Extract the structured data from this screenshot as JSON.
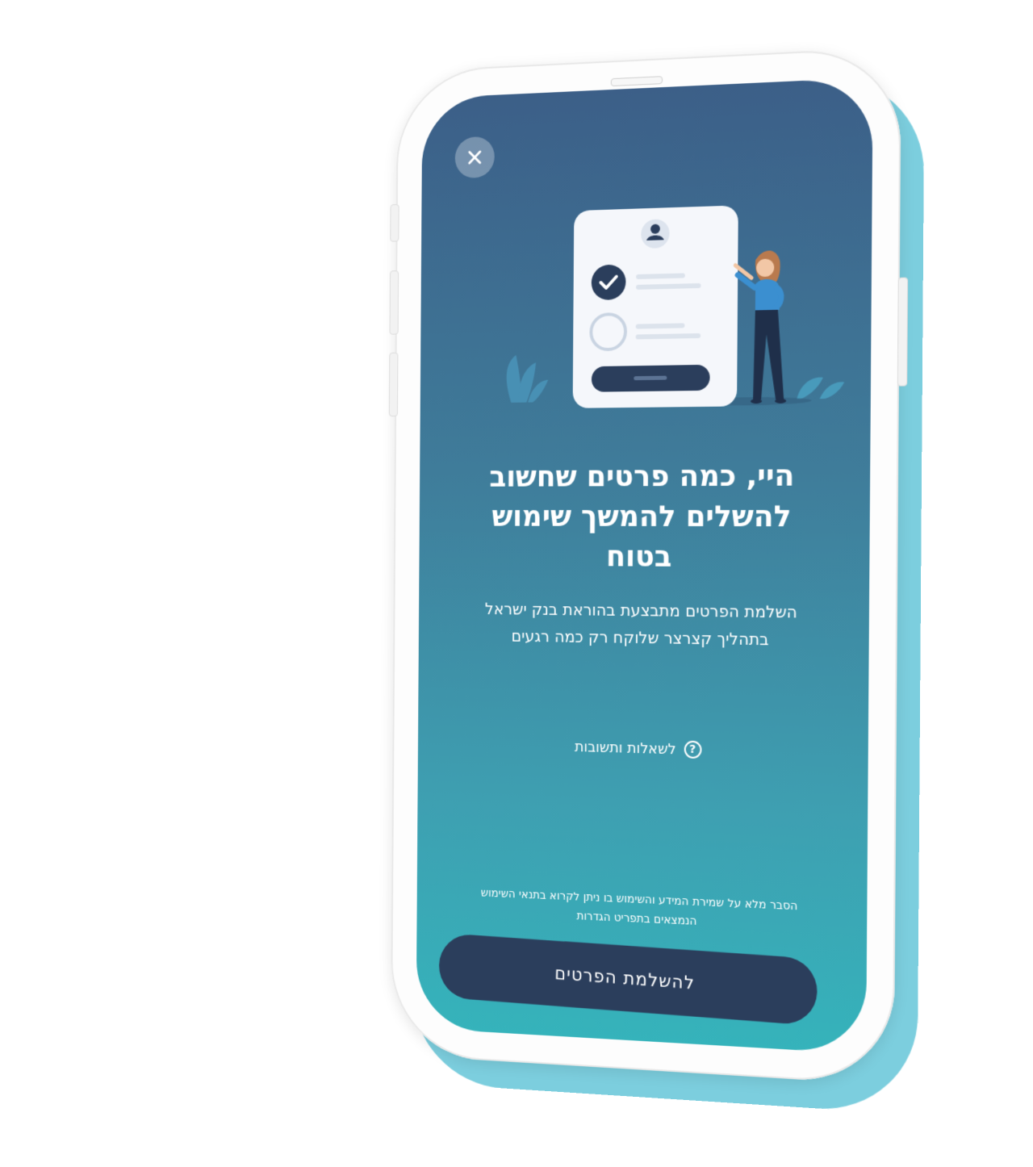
{
  "screen": {
    "close_icon": "close-icon",
    "title": "היי, כמה פרטים שחשוב להשלים להמשך שימוש בטוח",
    "subtitle": "השלמת הפרטים מתבצעת בהוראת בנק ישראל בתהליך קצרצר שלוקח רק כמה רגעים",
    "faq": {
      "icon": "question-icon",
      "icon_glyph": "?",
      "label": "לשאלות ותשובות"
    },
    "legal": "הסבר מלא על שמירת המידע והשימוש בו ניתן לקרוא בתנאי השימוש הנמצאים בתפריט הגדרות",
    "cta_label": "להשלמת הפרטים"
  },
  "colors": {
    "gradient_top": "#3c5f88",
    "gradient_bottom": "#35b3bb",
    "button": "#2b3e5c",
    "phone_accent": "#7ccede"
  }
}
